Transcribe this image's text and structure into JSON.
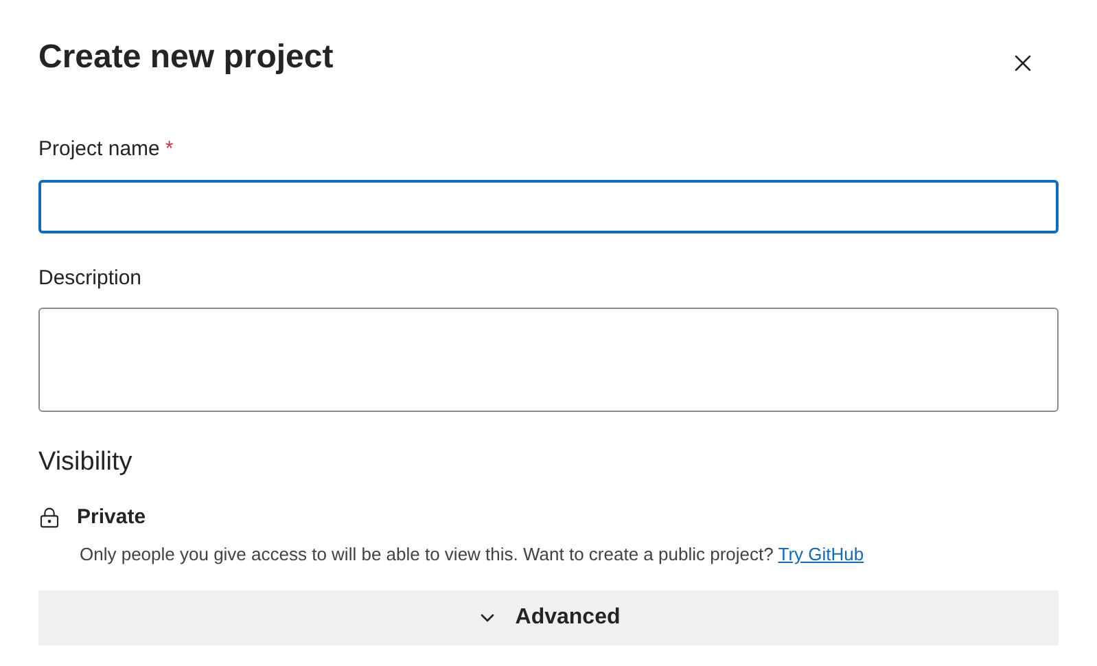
{
  "dialog": {
    "title": "Create new project"
  },
  "fields": [
    {
      "label": "Project name",
      "required_mark": "*",
      "kind": "input",
      "focused": true
    },
    {
      "label": "Description",
      "kind": "textarea",
      "focused": false
    }
  ],
  "visibility": {
    "heading": "Visibility",
    "option": "Private",
    "note": "Only people you give access to will be able to view this. Want to create a public project?",
    "link": "Try GitHub"
  },
  "advanced": {
    "label": "Advanced",
    "expanded": false
  }
}
